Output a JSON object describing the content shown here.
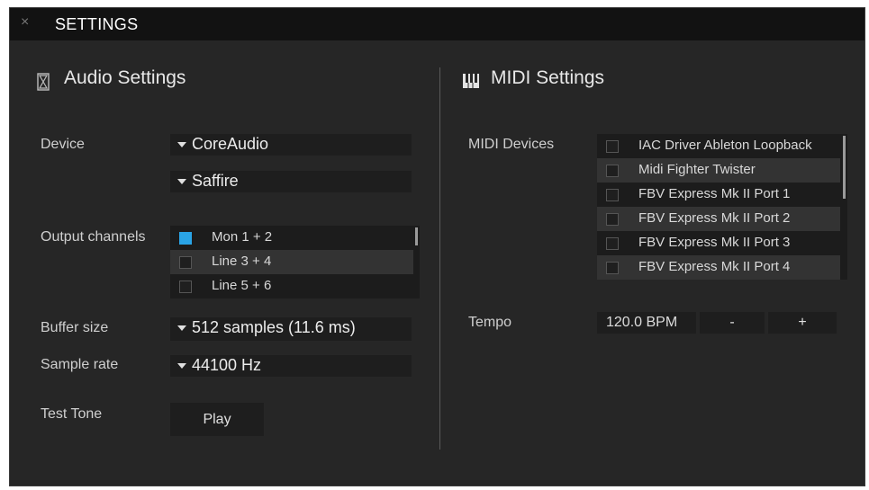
{
  "window": {
    "title": "SETTINGS",
    "close_icon": "×"
  },
  "audio": {
    "title": "Audio Settings",
    "device_label": "Device",
    "device_value": "CoreAudio",
    "device_sub_value": "Saffire",
    "output_label": "Output channels",
    "output_channels": [
      {
        "label": "Mon 1 + 2",
        "checked": true
      },
      {
        "label": "Line 3 + 4",
        "checked": false
      },
      {
        "label": "Line 5 + 6",
        "checked": false
      }
    ],
    "buffer_label": "Buffer size",
    "buffer_value": "512 samples (11.6 ms)",
    "sample_rate_label": "Sample rate",
    "sample_rate_value": "44100 Hz",
    "test_tone_label": "Test Tone",
    "play_label": "Play"
  },
  "midi": {
    "title": "MIDI Settings",
    "devices_label": "MIDI Devices",
    "devices": [
      {
        "label": "IAC Driver Ableton Loopback",
        "checked": false
      },
      {
        "label": "Midi Fighter Twister",
        "checked": false
      },
      {
        "label": "FBV Express Mk II Port 1",
        "checked": false
      },
      {
        "label": "FBV Express Mk II Port 2",
        "checked": false
      },
      {
        "label": "FBV Express Mk II Port 3",
        "checked": false
      },
      {
        "label": "FBV Express Mk II Port 4",
        "checked": false
      }
    ],
    "tempo_label": "Tempo",
    "tempo_value": "120.0 BPM",
    "minus_label": "-",
    "plus_label": "+"
  },
  "colors": {
    "accent": "#2aa4e6",
    "background": "#262626",
    "titlebar": "#121212"
  }
}
